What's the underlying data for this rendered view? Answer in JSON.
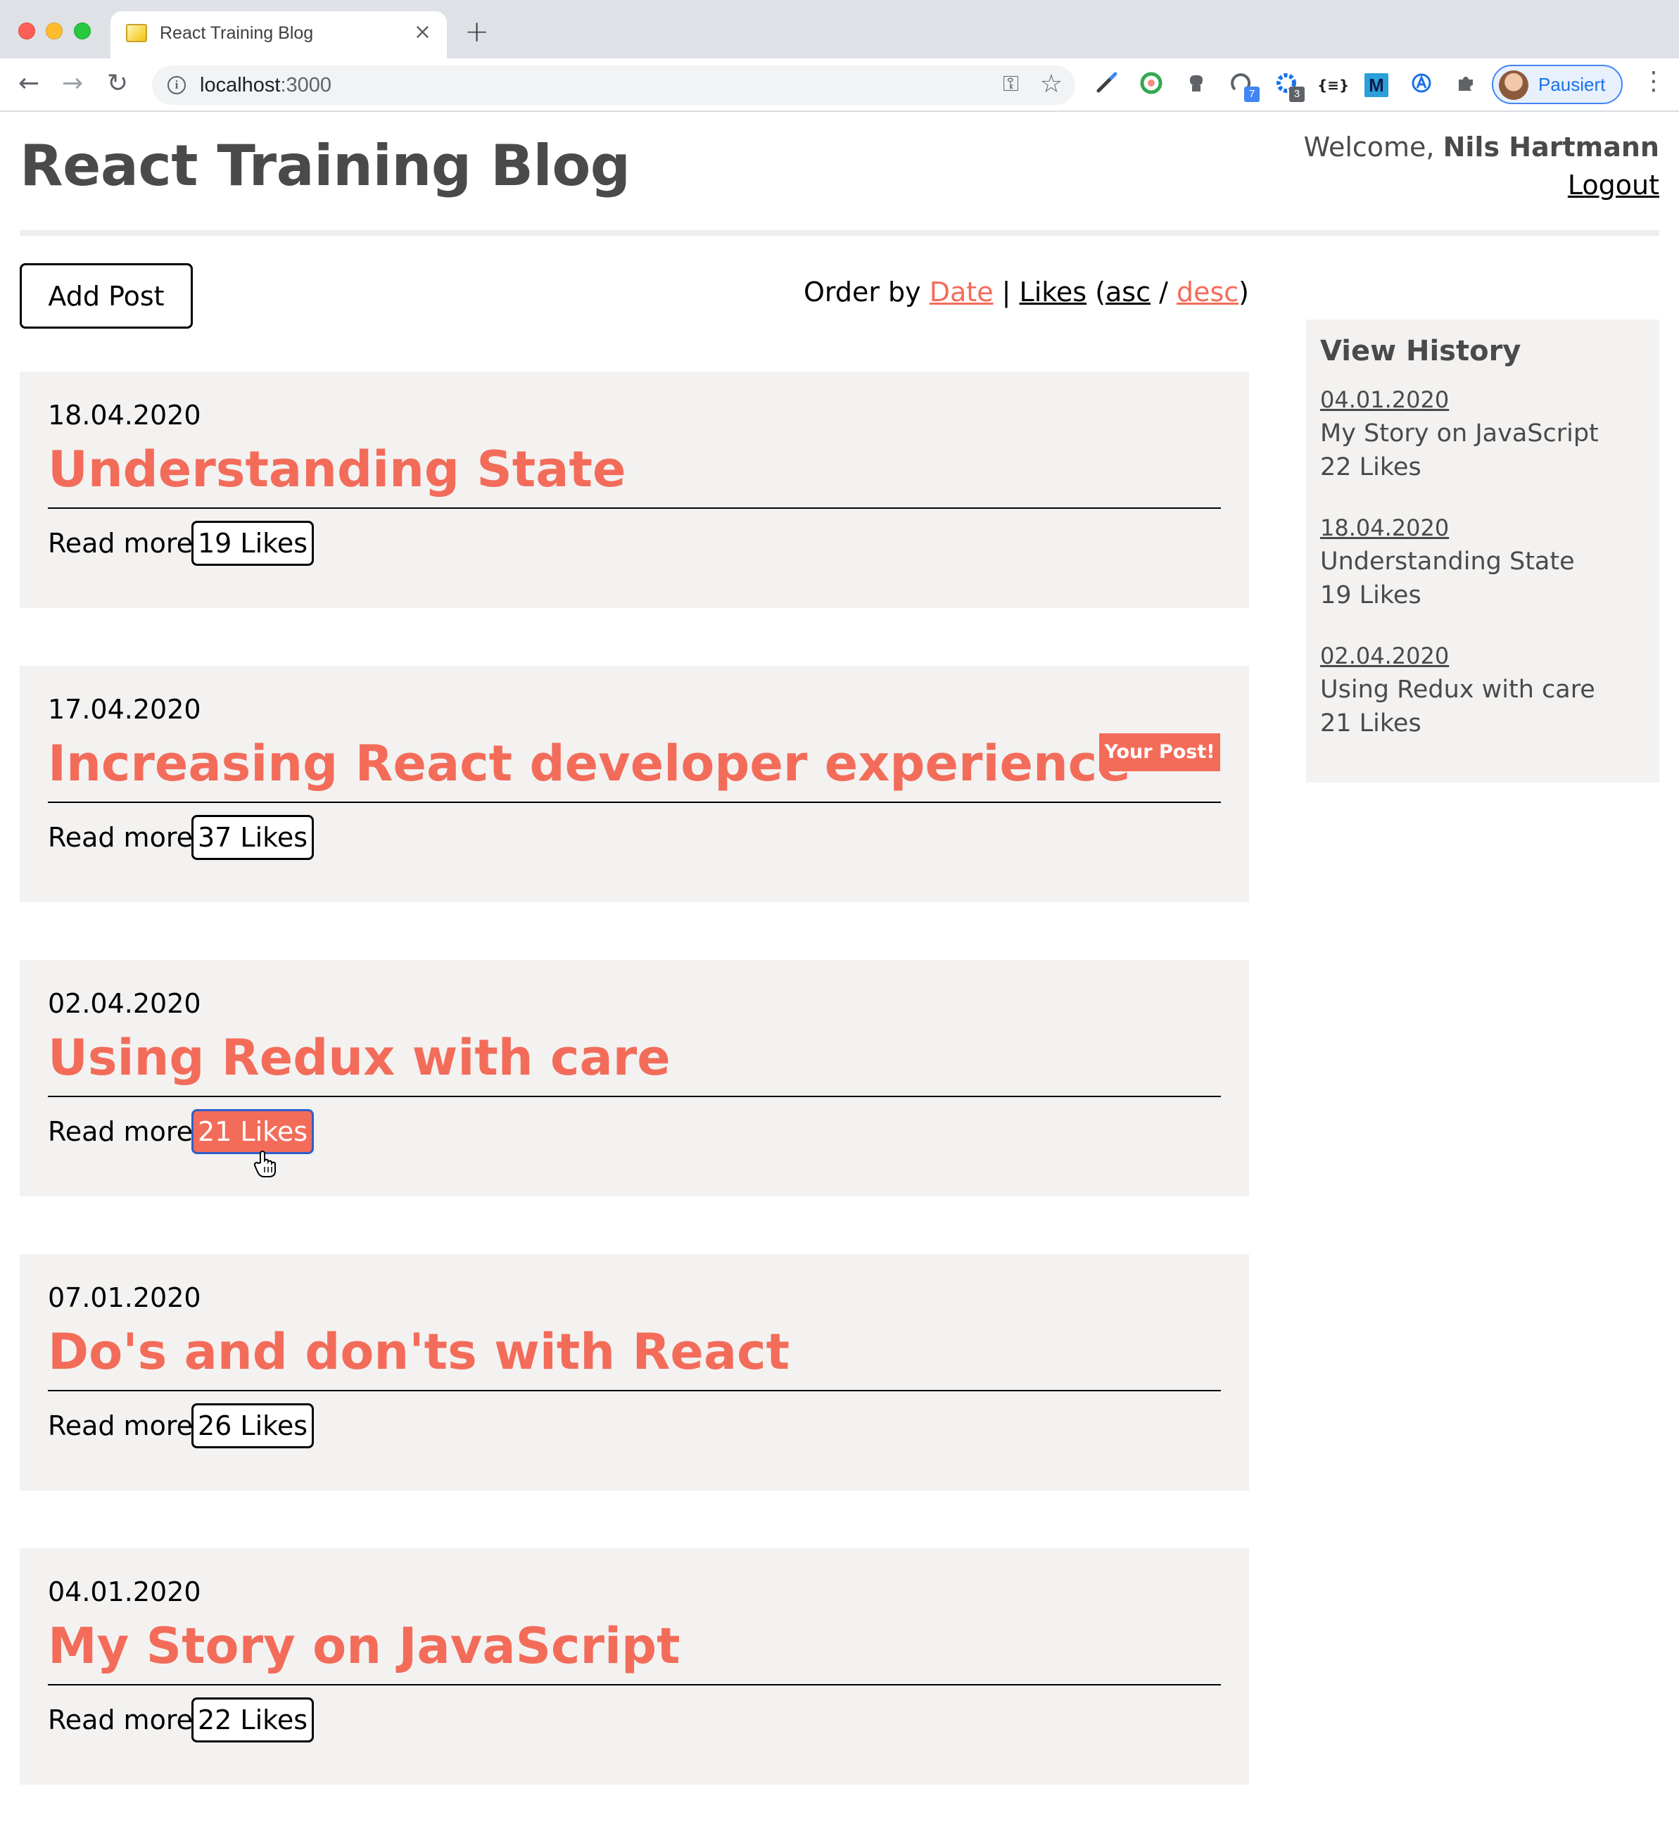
{
  "browser": {
    "tab_title": "React Training Blog",
    "tab_close": "×",
    "new_tab": "+",
    "url_host": "localhost",
    "url_port": ":3000",
    "profile_name": "Pausiert",
    "extension_badges": [
      "7",
      "3"
    ]
  },
  "header": {
    "title": "React Training Blog",
    "welcome_prefix": "Welcome, ",
    "user_name": "Nils Hartmann",
    "logout": "Logout"
  },
  "controls": {
    "add_post": "Add Post",
    "order_prefix": "Order by ",
    "order_date": "Date",
    "order_sep1": " | ",
    "order_likes": "Likes",
    "order_paren_open": " (",
    "order_asc": "asc",
    "order_slash": " / ",
    "order_desc": "desc",
    "order_paren_close": ")"
  },
  "posts": [
    {
      "date": "18.04.2020",
      "title": "Understanding State",
      "read_more": "Read more",
      "likes": "19 Likes"
    },
    {
      "date": "17.04.2020",
      "title": "Increasing React developer experience",
      "read_more": "Read more",
      "likes": "37 Likes",
      "badge": "Your Post!"
    },
    {
      "date": "02.04.2020",
      "title": "Using Redux with care",
      "read_more": "Read more",
      "likes": "21 Likes"
    },
    {
      "date": "07.01.2020",
      "title": "Do's and don'ts with React",
      "read_more": "Read more",
      "likes": "26 Likes"
    },
    {
      "date": "04.01.2020",
      "title": "My Story on JavaScript",
      "read_more": "Read more",
      "likes": "22 Likes"
    }
  ],
  "history": {
    "title": "View History",
    "items": [
      {
        "date": "04.01.2020",
        "title": "My Story on JavaScript",
        "likes": "22 Likes"
      },
      {
        "date": "18.04.2020",
        "title": "Understanding State",
        "likes": "19 Likes"
      },
      {
        "date": "02.04.2020",
        "title": "Using Redux with care",
        "likes": "21 Likes"
      }
    ]
  },
  "colors": {
    "accent": "#f36c5a",
    "card_bg": "#f3f2f1",
    "heading": "#4a4a4a"
  }
}
